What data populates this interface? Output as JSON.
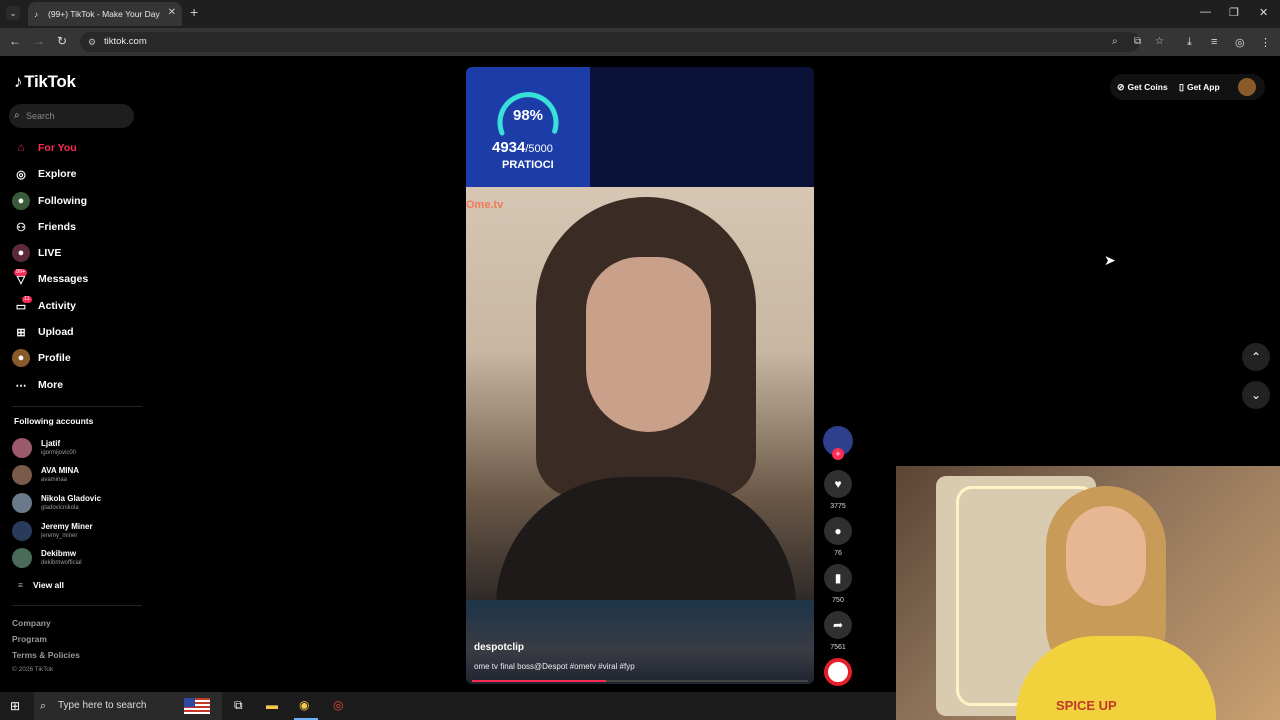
{
  "browser": {
    "tab_title": "(99+) TikTok - Make Your Day",
    "url": "tiktok.com",
    "tab_close": "✕",
    "new_tab": "+"
  },
  "sidebar": {
    "logo": "TikTok",
    "search_placeholder": "Search",
    "nav": [
      {
        "label": "For You",
        "icon": "home-icon",
        "active": true
      },
      {
        "label": "Explore",
        "icon": "compass-icon"
      },
      {
        "label": "Following",
        "icon": "following-icon"
      },
      {
        "label": "Friends",
        "icon": "friends-icon"
      },
      {
        "label": "LIVE",
        "icon": "live-icon"
      },
      {
        "label": "Messages",
        "icon": "messages-icon",
        "badge": "99+"
      },
      {
        "label": "Activity",
        "icon": "activity-icon",
        "badge": "11"
      },
      {
        "label": "Upload",
        "icon": "upload-icon"
      },
      {
        "label": "Profile",
        "icon": "profile-icon"
      },
      {
        "label": "More",
        "icon": "more-icon"
      }
    ],
    "following_title": "Following accounts",
    "accounts": [
      {
        "name": "Ljatif",
        "handle": "igormijovic00"
      },
      {
        "name": "AVA MINA",
        "handle": "avaminaa"
      },
      {
        "name": "Nikola Gladovic",
        "handle": "gladovicnikola"
      },
      {
        "name": "Jeremy Miner",
        "handle": "jeremy_miner"
      },
      {
        "name": "Dekibmw",
        "handle": "dekibmwofficial"
      }
    ],
    "view_all": "View all",
    "footer": [
      "Company",
      "Program",
      "Terms & Policies"
    ],
    "copyright": "© 2026 TikTok"
  },
  "video": {
    "gauge_percent": "98%",
    "gauge_percent_value": 98,
    "score": "4934",
    "score_total": "/5000",
    "score_label": "PRATIOCI",
    "watermark": "Ome.tv",
    "author": "despotclip",
    "description": "ome tv final boss@Despot #ometv #viral #fyp",
    "progress": 0.4
  },
  "actions": {
    "likes": "3775",
    "comments": "76",
    "saves": "750",
    "shares": "7561"
  },
  "topbar": {
    "get_coins": "Get Coins",
    "get_app": "Get App"
  },
  "webcam": {
    "shirt_text": "SPICE UP"
  },
  "taskbar": {
    "search_placeholder": "Type here to search"
  },
  "colors": {
    "accent": "#fe2c55",
    "background": "#000000"
  }
}
